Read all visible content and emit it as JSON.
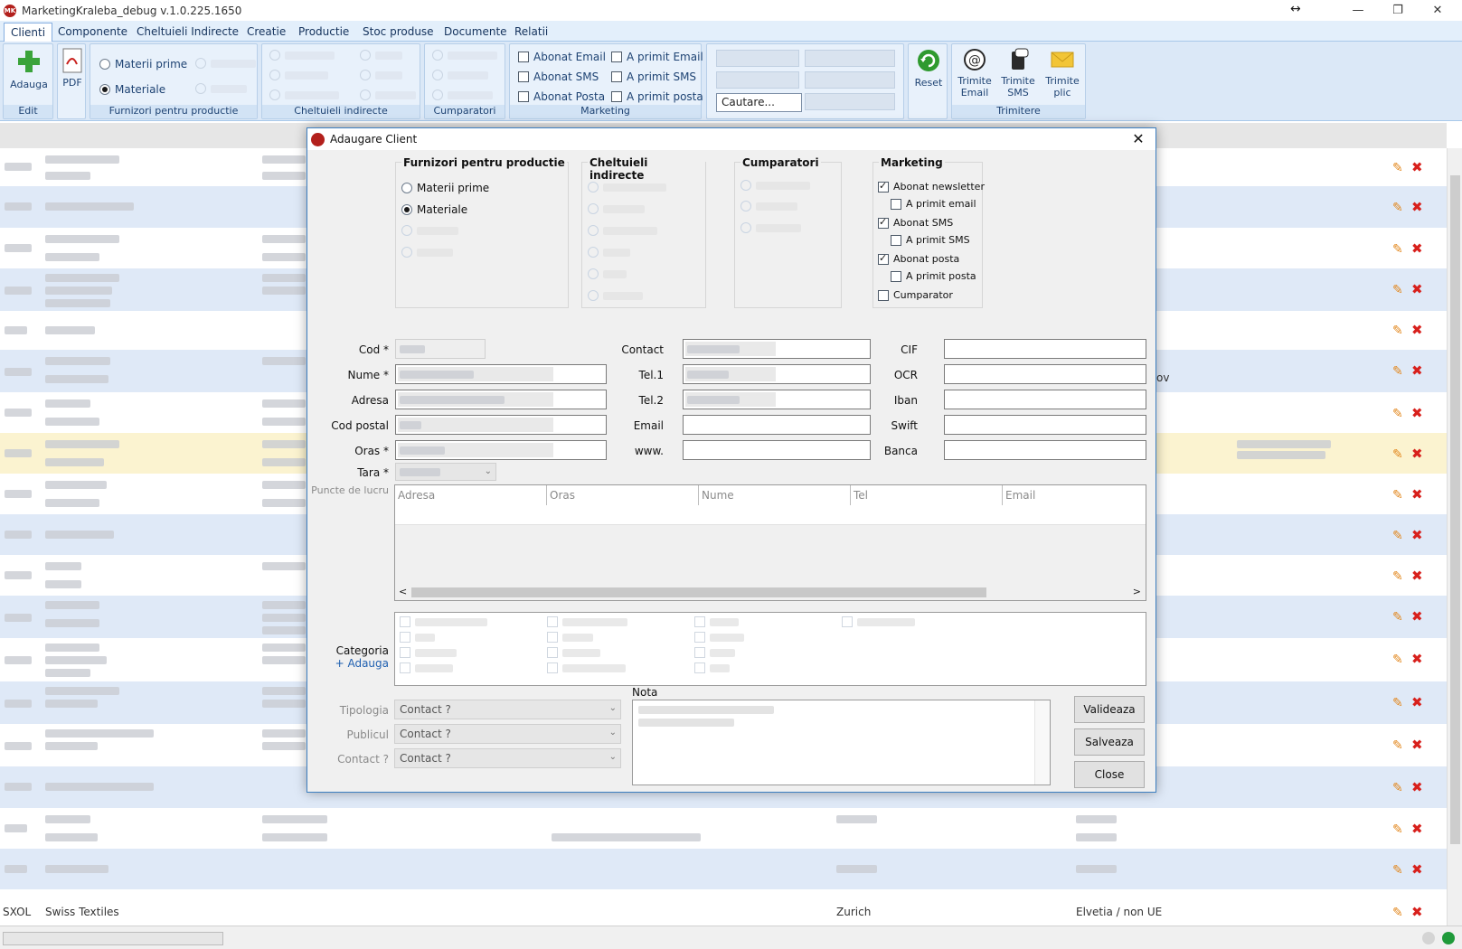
{
  "window": {
    "title": "MarketingKraleba_debug v.1.0.225.1650",
    "logo_text": "MK",
    "resize_glyph": "↔",
    "minimize": "—",
    "restore": "❐",
    "close": "✕"
  },
  "menu": {
    "tabs": [
      "Clienti",
      "Componente",
      "Cheltuieli Indirecte",
      "Creatie",
      "Productie",
      "Stoc produse",
      "Documente",
      "Relatii"
    ]
  },
  "ribbon": {
    "edit": {
      "add_label": "Adauga",
      "caption": "Edit"
    },
    "pdf": {
      "label": "PDF"
    },
    "furnizori": {
      "caption": "Furnizori pentru productie",
      "materii_prime": "Materii prime",
      "materiale": "Materiale"
    },
    "cheltuieli": {
      "caption": "Cheltuieli indirecte"
    },
    "cumparatori": {
      "caption": "Cumparatori"
    },
    "marketing": {
      "caption": "Marketing",
      "abonat_email": "Abonat Email",
      "abonat_sms": "Abonat SMS",
      "abonat_posta": "Abonat Posta",
      "primit_email": "A primit Email",
      "primit_sms": "A primit SMS",
      "primit_posta": "A primit posta"
    },
    "search": {
      "placeholder": "Cautare..."
    },
    "reset": {
      "label": "Reset"
    },
    "trimitere": {
      "caption": "Trimitere",
      "email_1": "Trimite",
      "email_2": "Email",
      "sms_1": "Trimite",
      "sms_2": "SMS",
      "plic_1": "Trimite",
      "plic_2": "plic"
    }
  },
  "grid": {
    "row_codes": {
      "last": "SXOL",
      "last_name": "Swiss Textiles",
      "last_city": "Zurich",
      "last_country": "Elvetia / non UE",
      "partial_text": "ov"
    }
  },
  "dialog": {
    "title": "Adaugare Client",
    "close_glyph": "✕",
    "furnizori": {
      "title": "Furnizori pentru productie",
      "materii_prime": "Materii prime",
      "materiale": "Materiale"
    },
    "cheltuieli": {
      "title": "Cheltuieli indirecte"
    },
    "cumparatori": {
      "title": "Cumparatori"
    },
    "marketing": {
      "title": "Marketing",
      "abonat_newsletter": "Abonat newsletter",
      "primit_email": "A primit email",
      "abonat_sms": "Abonat SMS",
      "primit_sms": "A primit SMS",
      "abonat_posta": "Abonat posta",
      "primit_posta": "A primit posta",
      "cumparator": "Cumparator"
    },
    "labels": {
      "cod": "Cod *",
      "nume": "Nume *",
      "adresa": "Adresa",
      "cod_postal": "Cod postal",
      "oras": "Oras *",
      "tara": "Tara *",
      "puncte_lucru": "Puncte de lucru",
      "contact": "Contact",
      "tel1": "Tel.1",
      "tel2": "Tel.2",
      "email": "Email",
      "www": "www.",
      "cif": "CIF",
      "ocr": "OCR",
      "iban": "Iban",
      "swift": "Swift",
      "banca": "Banca",
      "categoria": "Categoria",
      "adauga": "+ Adauga",
      "tipologia": "Tipologia",
      "publicul": "Publicul",
      "contact_q": "Contact ?",
      "nota": "Nota"
    },
    "worktable": {
      "columns": [
        "Adresa",
        "Oras",
        "Nume",
        "Tel",
        "Email"
      ],
      "scroll_left": "<",
      "scroll_right": ">"
    },
    "combos": {
      "tipologia": "Contact ?",
      "publicul": "Contact ?",
      "contact": "Contact ?"
    },
    "buttons": {
      "valideaza": "Valideaza",
      "salveaza": "Salveaza",
      "close": "Close"
    }
  },
  "colors": {
    "accent": "#3d7fc1",
    "ribbon": "#dbe8f7",
    "alt_row": "#dfe9f7",
    "selected_row": "#fbf3d0",
    "delete": "#d8201c",
    "edit": "#e2861b"
  }
}
